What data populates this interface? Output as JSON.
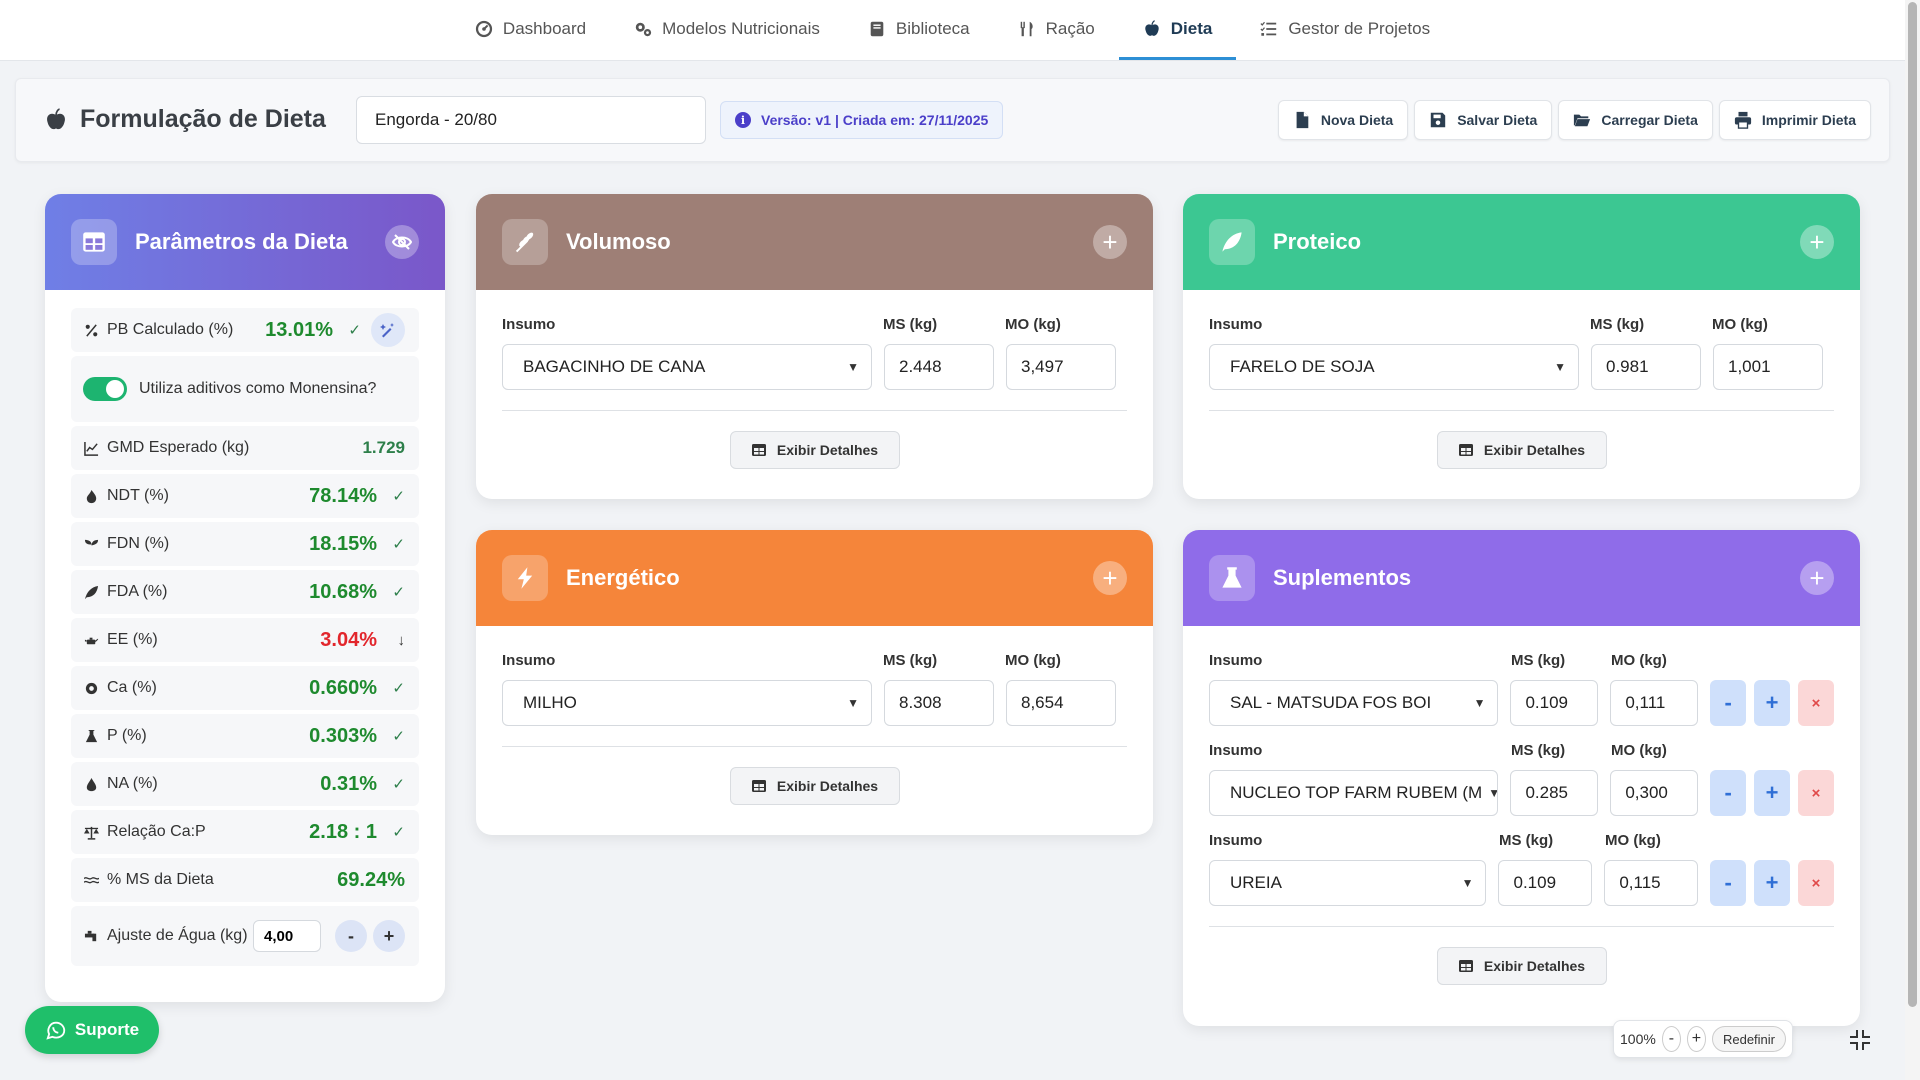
{
  "nav": {
    "items": [
      {
        "label": "Dashboard",
        "icon": "gauge-icon"
      },
      {
        "label": "Modelos Nutricionais",
        "icon": "cogs-icon"
      },
      {
        "label": "Biblioteca",
        "icon": "book-icon"
      },
      {
        "label": "Ração",
        "icon": "utensils-icon"
      },
      {
        "label": "Dieta",
        "icon": "apple-icon"
      },
      {
        "label": "Gestor de Projetos",
        "icon": "list-check-icon"
      }
    ],
    "active": "Dieta"
  },
  "header": {
    "title": "Formulação de Dieta",
    "diet_name": "Engorda - 20/80",
    "version_text": "Versão: v1 | Criada em: 27/11/2025",
    "actions": [
      "Nova Dieta",
      "Salvar Dieta",
      "Carregar Dieta",
      "Imprimir Dieta"
    ]
  },
  "params": {
    "title": "Parâmetros da Dieta",
    "pb": {
      "label": "PB Calculado (%)",
      "value": "13.01%",
      "mark": "✓"
    },
    "monensina": {
      "label": "Utiliza aditivos como Monensina?",
      "enabled": true
    },
    "gmd": {
      "label": "GMD Esperado (kg)",
      "value": "1.729"
    },
    "ndt": {
      "label": "NDT (%)",
      "value": "78.14%",
      "mark": "✓"
    },
    "fdn": {
      "label": "FDN (%)",
      "value": "18.15%",
      "mark": "✓"
    },
    "fda": {
      "label": "FDA (%)",
      "value": "10.68%",
      "mark": "✓"
    },
    "ee": {
      "label": "EE (%)",
      "value": "3.04%",
      "mark": "↓"
    },
    "ca": {
      "label": "Ca (%)",
      "value": "0.660%",
      "mark": "✓"
    },
    "p": {
      "label": "P (%)",
      "value": "0.303%",
      "mark": "✓"
    },
    "na": {
      "label": "NA (%)",
      "value": "0.31%",
      "mark": "✓"
    },
    "cap": {
      "label": "Relação Ca:P",
      "value": "2.18 : 1",
      "mark": "✓"
    },
    "ms": {
      "label": "% MS da Dieta",
      "value": "69.24%"
    },
    "water": {
      "label": "Ajuste de Água (kg)",
      "value": "4,00",
      "minus": "-",
      "plus": "+"
    }
  },
  "labels": {
    "insumo": "Insumo",
    "ms": "MS (kg)",
    "mo": "MO (kg)",
    "details": "Exibir Detalhes"
  },
  "volumoso": {
    "title": "Volumoso",
    "color": "#9e7f76",
    "rows": [
      {
        "insumo": "BAGACINHO DE CANA",
        "ms": "2.448",
        "mo": "3,497"
      }
    ]
  },
  "proteico": {
    "title": "Proteico",
    "color": "#3cc792",
    "rows": [
      {
        "insumo": "FARELO DE SOJA",
        "ms": "0.981",
        "mo": "1,001"
      }
    ]
  },
  "energetico": {
    "title": "Energético",
    "color": "#f5853a",
    "rows": [
      {
        "insumo": "MILHO",
        "ms": "8.308",
        "mo": "8,654"
      }
    ]
  },
  "suplementos": {
    "title": "Suplementos",
    "color": "#8f6ce9",
    "rows": [
      {
        "insumo": "SAL - MATSUDA FOS BOI",
        "ms": "0.109",
        "mo": "0,111"
      },
      {
        "insumo": "NUCLEO TOP FARM RUBEM (M",
        "ms": "0.285",
        "mo": "0,300"
      },
      {
        "insumo": "UREIA",
        "ms": "0.109",
        "mo": "0,115"
      }
    ],
    "btn_minus": "-",
    "btn_plus": "+",
    "btn_remove": "×"
  },
  "support": {
    "label": "Suporte"
  },
  "zoom": {
    "level": "100%",
    "minus": "-",
    "plus": "+",
    "reset": "Redefinir"
  }
}
